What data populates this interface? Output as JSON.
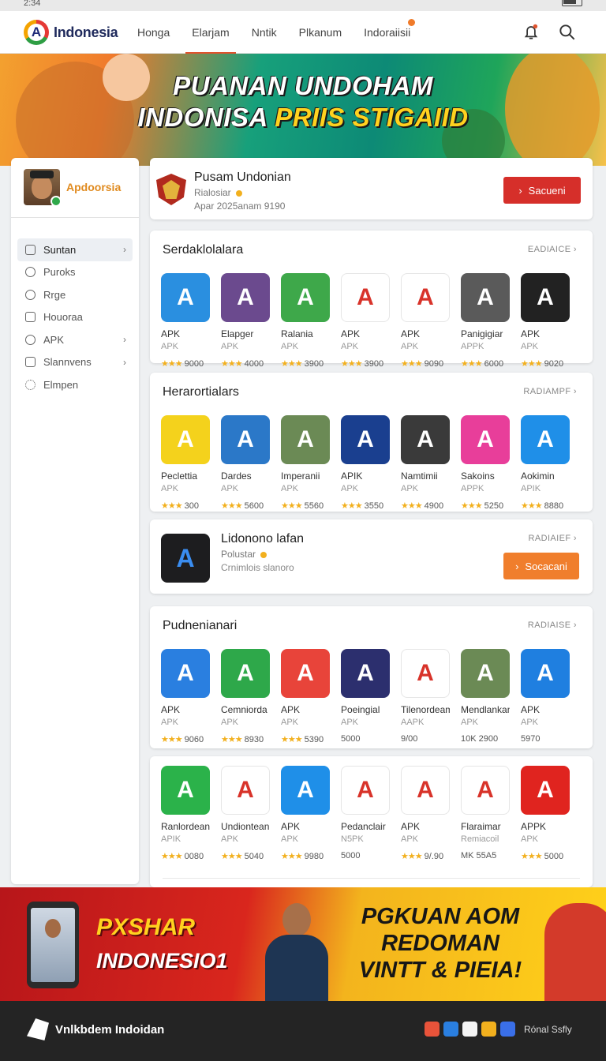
{
  "status": {
    "time": "2:34"
  },
  "brand": {
    "name": "Indonesia"
  },
  "nav": [
    {
      "label": "Honga"
    },
    {
      "label": "Elarjam"
    },
    {
      "label": "Nntik"
    },
    {
      "label": "Plkanum"
    },
    {
      "label": "Indoraiisii"
    }
  ],
  "hero": {
    "line1": "PUANAN UNDOHAM",
    "line2_white": "INDONISA ",
    "line2_yellow": "PRIIS STIGAIID"
  },
  "sidebar": {
    "profile_name": "Apdoorsia",
    "items": [
      {
        "label": "Suntan",
        "icon": "square-icon",
        "chevron": true
      },
      {
        "label": "Puroks",
        "icon": "chat-icon",
        "chevron": false
      },
      {
        "label": "Rrge",
        "icon": "circle-icon",
        "chevron": false
      },
      {
        "label": "Houoraa",
        "icon": "doc-icon",
        "chevron": false
      },
      {
        "label": "APK",
        "icon": "target-icon",
        "chevron": true
      },
      {
        "label": "Slannvens",
        "icon": "window-icon",
        "chevron": true
      },
      {
        "label": "Elmpen",
        "icon": "gear-icon",
        "chevron": false
      }
    ]
  },
  "featured": {
    "title": "Pusam Undonian",
    "sub": "Rialosiar",
    "meta": "Apar 2025anam 9190",
    "button": "Sacueni"
  },
  "section1": {
    "title": "Serdaklolalara",
    "more": "EADIAICE",
    "apps": [
      {
        "name": "APK",
        "sub": "APK",
        "rating": "9000",
        "bg": "#2a8fe0"
      },
      {
        "name": "Elapger",
        "sub": "APK",
        "rating": "4000",
        "bg": "#6b4a8e"
      },
      {
        "name": "Ralania",
        "sub": "APK",
        "rating": "3900",
        "bg": "#3ea84a"
      },
      {
        "name": "APK",
        "sub": "APK",
        "rating": "3900",
        "bg": "#ffffff"
      },
      {
        "name": "APK",
        "sub": "APK",
        "rating": "9090",
        "bg": "#ffffff"
      },
      {
        "name": "Panigigiar",
        "sub": "APPK",
        "rating": "6000",
        "bg": "#5a5a5a"
      },
      {
        "name": "APK",
        "sub": "APK",
        "rating": "9020",
        "bg": "#222222"
      }
    ]
  },
  "section2": {
    "title": "Herarortialars",
    "more": "RADIAMPF",
    "apps": [
      {
        "name": "Peclettia",
        "sub": "APK",
        "rating": "300",
        "bg": "#f4d21c"
      },
      {
        "name": "Dardes",
        "sub": "APK",
        "rating": "5600",
        "bg": "#2b78c8"
      },
      {
        "name": "Imperanii",
        "sub": "APK",
        "rating": "5560",
        "bg": "#6b8a55"
      },
      {
        "name": "APIK",
        "sub": "APK",
        "rating": "3550",
        "bg": "#1a3f8f"
      },
      {
        "name": "Namtimii",
        "sub": "APK",
        "rating": "4900",
        "bg": "#3a3a3a"
      },
      {
        "name": "Sakoins",
        "sub": "APPK",
        "rating": "5250",
        "bg": "#e83e9a"
      },
      {
        "name": "Aokimin",
        "sub": "APIK",
        "rating": "8880",
        "bg": "#1f8fe8"
      }
    ]
  },
  "solo": {
    "title": "Lidonono lafan",
    "sub": "Polustar",
    "meta": "Crnimlois slanoro",
    "more": "RADIAIEF",
    "button": "Socacani"
  },
  "section3": {
    "title": "Pudnenianari",
    "more": "RADIAISE",
    "apps": [
      {
        "name": "APK",
        "sub": "APK",
        "rating": "9060",
        "stars": true,
        "bg": "#2a7fe0"
      },
      {
        "name": "Cemniorda",
        "sub": "APK",
        "rating": "8930",
        "stars": true,
        "bg": "#2ea84a"
      },
      {
        "name": "APK",
        "sub": "APK",
        "rating": "5390",
        "stars": true,
        "bg": "#e8443a"
      },
      {
        "name": "Poeingial",
        "sub": "APK",
        "rating": "5000",
        "stars": false,
        "bg": "#2c2f6e"
      },
      {
        "name": "Tilenordeam",
        "sub": "AAPK",
        "rating": "9/00",
        "stars": false,
        "bg": "#ffffff"
      },
      {
        "name": "Mendlankan",
        "sub": "APK",
        "rating": "10K 2900",
        "stars": false,
        "bg": "#6b8a55"
      },
      {
        "name": "APK",
        "sub": "APK",
        "rating": "5970",
        "stars": false,
        "bg": "#1f7fe0"
      }
    ]
  },
  "section4": {
    "apps": [
      {
        "name": "Ranlordean",
        "sub": "APIK",
        "rating": "0080",
        "stars": true,
        "bg": "#2bb24a"
      },
      {
        "name": "Undiontean",
        "sub": "APK",
        "rating": "5040",
        "stars": true,
        "bg": "#ffffff"
      },
      {
        "name": "APK",
        "sub": "APK",
        "rating": "9980",
        "stars": true,
        "bg": "#1f8fe8"
      },
      {
        "name": "Pedanclair",
        "sub": "N5PK",
        "rating": "5000",
        "stars": false,
        "bg": "#ffffff"
      },
      {
        "name": "APK",
        "sub": "APK",
        "rating": "9/.90",
        "stars": true,
        "bg": "#ffffff"
      },
      {
        "name": "Flaraimar",
        "sub": "Remiacoil",
        "rating": "MK 55A5",
        "stars": false,
        "bg": "#ffffff"
      },
      {
        "name": "APPK",
        "sub": "APK",
        "rating": "5000",
        "stars": true,
        "bg": "#e0241f"
      }
    ]
  },
  "promo": {
    "left1": "PXSHAR",
    "left2": "INDONESIO1",
    "right1": "PGKUAN AOM",
    "right2": "REDOMAN",
    "right3": "VINTT & PIEIA!"
  },
  "footer": {
    "brand": "Vnlkbdem Indoidan",
    "social_label": "Rónal Ssfly",
    "social_colors": [
      "#e8533a",
      "#2a7fe0",
      "#f4f4f4",
      "#f2b01e",
      "#3a6fe8"
    ]
  },
  "colors": {
    "accent": "#e0532e",
    "cta_red": "#d62f2a",
    "cta_orange": "#f07e2c",
    "star": "#f2b01e"
  }
}
